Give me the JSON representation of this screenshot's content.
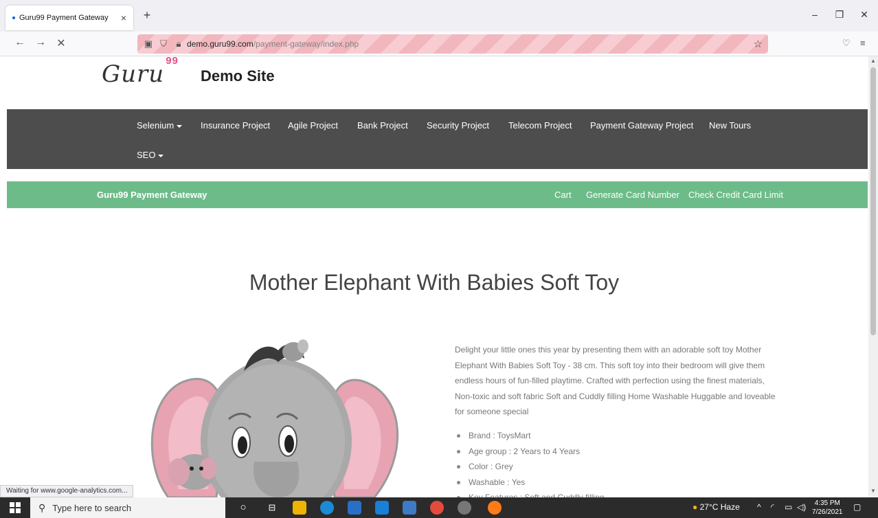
{
  "browser": {
    "tab_title": "Guru99 Payment Gateway",
    "url_host": "demo.guru99.com",
    "url_path": "/payment-gateway/index.php"
  },
  "site": {
    "logo_text": "Guru",
    "logo_sup": "99",
    "title": "Demo Site"
  },
  "main_nav": {
    "items": [
      {
        "label": "Selenium"
      },
      {
        "label": "Insurance Project"
      },
      {
        "label": "Agile Project"
      },
      {
        "label": "Bank Project"
      },
      {
        "label": "Security Project"
      },
      {
        "label": "Telecom Project"
      },
      {
        "label": "Payment Gateway Project"
      },
      {
        "label": "New Tours"
      },
      {
        "label": "SEO"
      }
    ]
  },
  "gateway_nav": {
    "brand": "Guru99 Payment Gateway",
    "links": [
      {
        "label": "Cart"
      },
      {
        "label": "Generate Card Number"
      },
      {
        "label": "Check Credit Card Limit"
      }
    ]
  },
  "product": {
    "title": "Mother Elephant With Babies Soft Toy",
    "description": "Delight your little ones this year by presenting them with an adorable soft toy Mother Elephant With Babies Soft Toy - 38 cm. This soft toy into their bedroom will give them endless hours of fun-filled playtime. Crafted with perfection using the finest materials, Non-toxic and soft fabric Soft and Cuddly filling Home Washable Huggable and loveable for someone special",
    "specs": [
      "Brand : ToysMart",
      "Age group : 2 Years to 4 Years",
      "Color : Grey",
      "Washable : Yes",
      "Key Features : Soft and Cuddly filling"
    ]
  },
  "status_text": "Waiting for www.google-analytics.com...",
  "taskbar": {
    "search_placeholder": "Type here to search",
    "weather": "27°C  Haze",
    "time": "4:35 PM",
    "date": "7/26/2021"
  },
  "colors": {
    "nav_bg": "#4d4d4d",
    "gateway_bg": "#6ebb8a",
    "logo_accent": "#e94f89"
  }
}
